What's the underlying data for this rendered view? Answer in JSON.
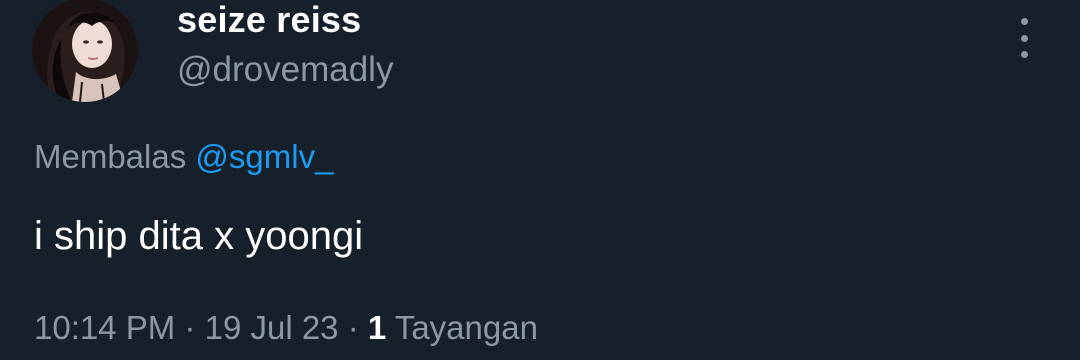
{
  "author": {
    "display_name": "seize reiss",
    "handle": "@drovemadly",
    "avatar_icon": "profile-photo"
  },
  "reply": {
    "prefix": "Membalas",
    "mention": "@sgmlv_"
  },
  "tweet": {
    "text": "i ship dita x yoongi"
  },
  "meta": {
    "time": "10:14 PM",
    "separator": "·",
    "date": "19 Jul 23",
    "views_count": "1",
    "views_label": "Tayangan"
  },
  "colors": {
    "background": "#15202b",
    "primary_text": "#ffffff",
    "secondary_text": "#8b98a5",
    "link": "#1d9bf0"
  },
  "menu": {
    "icon": "more-vertical-icon"
  }
}
